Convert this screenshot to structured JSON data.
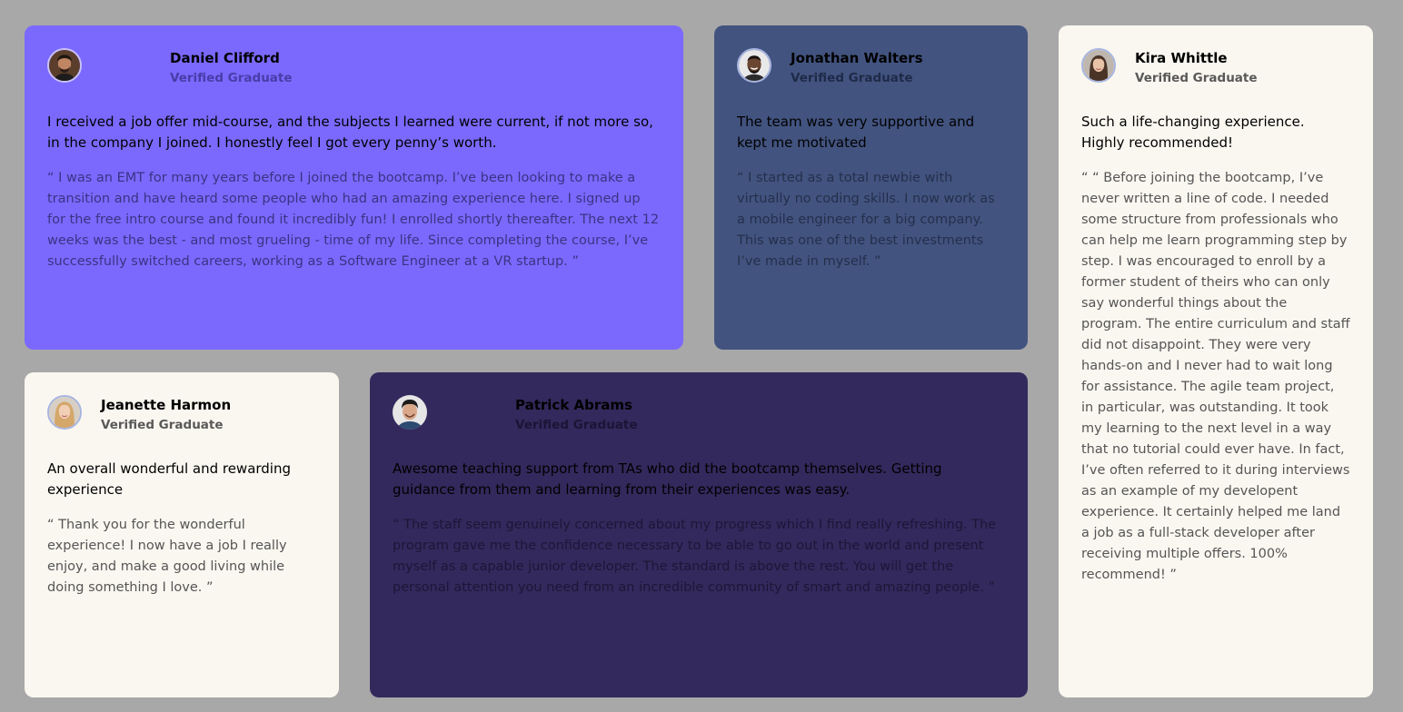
{
  "testimonials": [
    {
      "name": "Daniel Clifford",
      "role": "Verified Graduate",
      "headline": "I received a job offer mid-course, and the subjects I learned were current, if not more so, in the company I joined. I honestly feel I got every penny’s worth.",
      "quote": "“ I was an EMT for many years before I joined the bootcamp. I’ve been looking to make a transition and have heard some people who had an amazing experience here. I signed up for the free intro course and found it incredibly fun! I enrolled shortly thereafter. The next 12 weeks was the best - and most grueling - time of my life. Since completing the course, I’ve successfully switched careers, working as a Software Engineer at a VR startup. ”",
      "avatar": "man-with-beard-avatar-icon",
      "color": "#7b69fe"
    },
    {
      "name": "Jonathan Walters",
      "role": "Verified Graduate",
      "headline": "The team was very supportive and kept me motivated",
      "quote": "“ I started as a total newbie with virtually no coding skills. I now work as a mobile engineer for a big company. This was one of the best investments I’ve made in myself. ”",
      "avatar": "smiling-man-avatar-icon",
      "color": "#42537f"
    },
    {
      "name": "Kira Whittle",
      "role": "Verified Graduate",
      "headline": "Such a life-changing experience. Highly recommended!",
      "quote": "“ “ Before joining the bootcamp, I’ve never written a line of code. I needed some structure from professionals who can help me learn programming step by step. I was encouraged to enroll by a former student of theirs who can only say wonderful things about the program. The entire curriculum and staff did not disappoint. They were very hands-on and I never had to wait long for assistance. The agile team project, in particular, was outstanding. It took my learning to the next level in a way that no tutorial could ever have. In fact, I’ve often referred to it during interviews as an example of my developent experience. It certainly helped me land a job as a full-stack developer after receiving multiple offers. 100% recommend! ”",
      "avatar": "woman-dark-hair-avatar-icon",
      "color": "#faf7f0"
    },
    {
      "name": "Jeanette Harmon",
      "role": "Verified Graduate",
      "headline": "An overall wonderful and rewarding experience",
      "quote": "“ Thank you for the wonderful experience! I now have a job I really enjoy, and make a good living while doing something I love. ”",
      "avatar": "woman-blonde-hair-avatar-icon",
      "color": "#faf7f0"
    },
    {
      "name": "Patrick Abrams",
      "role": "Verified Graduate",
      "headline": "Awesome teaching support from TAs who did the bootcamp themselves. Getting guidance from them and learning from their experiences was easy.",
      "quote": "“ The staff seem genuinely concerned about my progress which I find really refreshing. The program gave me the confidence necessary to be able to go out in the world and present myself as a capable junior developer. The standard is above the rest. You will get the personal attention you need from an incredible community of smart and amazing people. ”",
      "avatar": "man-dark-hair-avatar-icon",
      "color": "#33295c"
    }
  ]
}
